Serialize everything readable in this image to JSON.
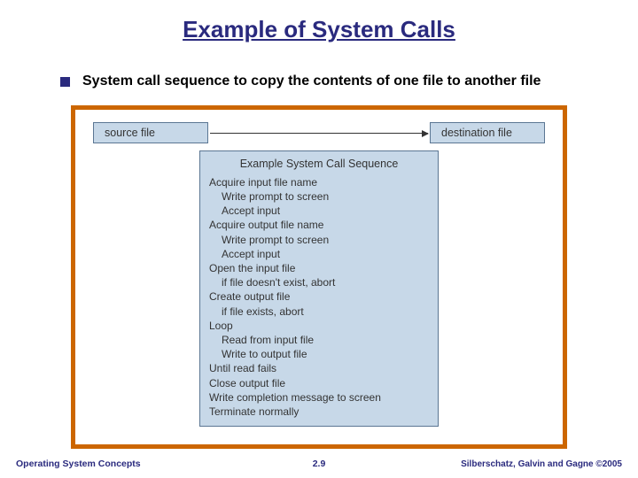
{
  "title": "Example of System Calls",
  "bullet": "System call sequence to copy the contents of one file to another file",
  "diagram": {
    "source_label": "source file",
    "dest_label": "destination  file",
    "seq_title": "Example System Call Sequence",
    "lines": {
      "l0": "Acquire input file name",
      "l1": "Write prompt to screen",
      "l2": "Accept input",
      "l3": "Acquire output file name",
      "l4": "Write prompt to screen",
      "l5": "Accept input",
      "l6": "Open the input file",
      "l7": "if file doesn't exist, abort",
      "l8": "Create output file",
      "l9": "if file exists, abort",
      "l10": "Loop",
      "l11": "Read from input file",
      "l12": "Write to output file",
      "l13": "Until read fails",
      "l14": "Close output file",
      "l15": "Write completion message to screen",
      "l16": "Terminate normally"
    }
  },
  "footer": {
    "left": "Operating System Concepts",
    "center": "2.9",
    "right": "Silberschatz, Galvin and Gagne ©2005"
  }
}
